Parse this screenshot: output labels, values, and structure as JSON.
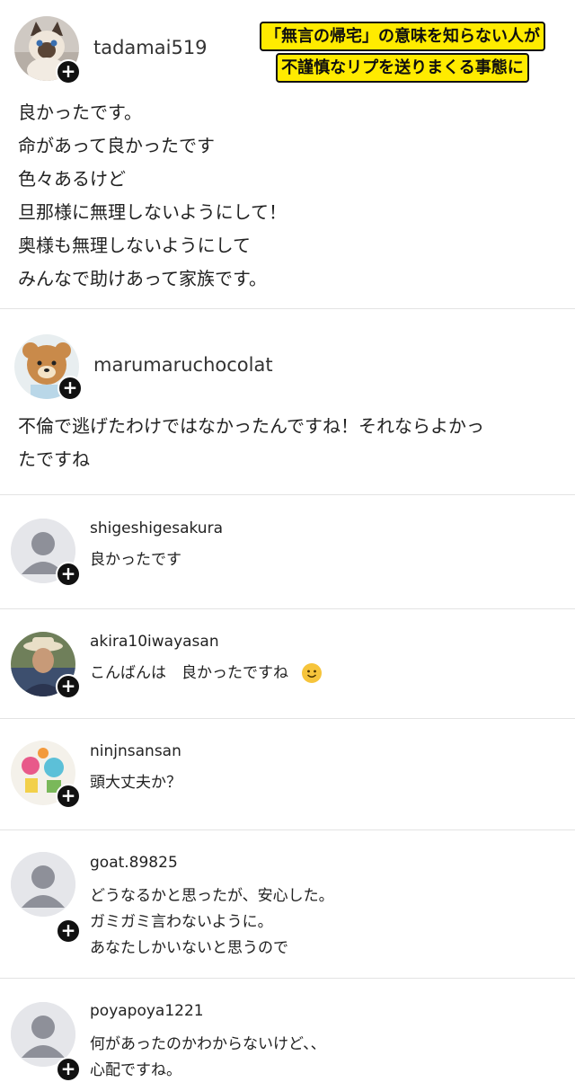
{
  "caption": {
    "line1": "「無言の帰宅」の意味を知らない人が",
    "line2": "不謹慎なリプを送りまくる事態に"
  },
  "comments": [
    {
      "user": "tadamai519",
      "lines": [
        "良かったです。",
        "命があって良かったです",
        "色々あるけど",
        "旦那様に無理しないようにして！",
        "奥様も無理しないようにして",
        "みんなで助けあって家族です。"
      ]
    },
    {
      "user": "marumaruchocolat",
      "lines": [
        "不倫で逃げたわけではなかったんですね！それならよかっ",
        "たですね"
      ]
    },
    {
      "user": "shigeshigesakura",
      "lines": [
        "良かったです"
      ]
    },
    {
      "user": "akira10iwayasan",
      "lines": [
        "こんばんは　良かったですね"
      ],
      "emoji": "smiling-face"
    },
    {
      "user": "ninjnsansan",
      "lines": [
        "頭大丈夫か？"
      ]
    },
    {
      "user": "goat.89825",
      "lines": [
        "どうなるかと思ったが、安心した。",
        "ガミガミ言わないように。",
        "あなたしかいないと思うので"
      ]
    },
    {
      "user": "poyapoya1221",
      "lines": [
        "何があったのかわからないけど、、",
        "心配ですね。"
      ]
    }
  ],
  "follow_symbol": "+",
  "colors": {
    "caption_bg": "#ffeb00",
    "divider": "#e3e3e3",
    "follow_bg": "#111111"
  }
}
